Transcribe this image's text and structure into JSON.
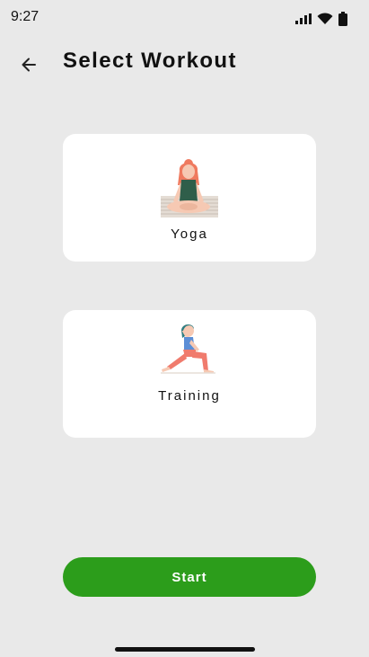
{
  "status_bar": {
    "time": "9:27"
  },
  "header": {
    "title": "Select Workout"
  },
  "workouts": [
    {
      "label": "Yoga",
      "icon": "yoga-pose-icon"
    },
    {
      "label": "Training",
      "icon": "lunge-stretch-icon"
    }
  ],
  "actions": {
    "start_label": "Start"
  },
  "colors": {
    "background": "#e9e9e9",
    "card": "#ffffff",
    "accent": "#2c9d1b"
  }
}
